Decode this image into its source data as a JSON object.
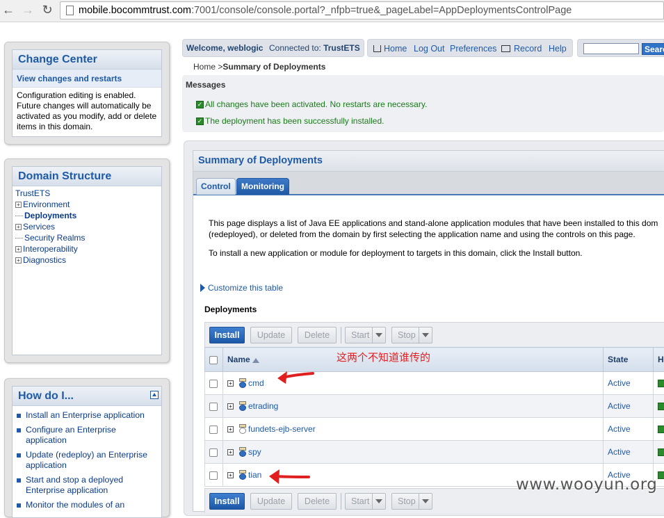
{
  "browser": {
    "url_host": "mobile.bocommtrust.com",
    "url_rest": ":7001/console/console.portal?_nfpb=true&_pageLabel=AppDeploymentsControlPage"
  },
  "change_center": {
    "title": "Change Center",
    "subtitle": "View changes and restarts",
    "text": "Configuration editing is enabled. Future changes will automatically be activated as you modify, add or delete items in this domain."
  },
  "domain_structure": {
    "title": "Domain Structure",
    "root": "TrustETS",
    "items": [
      {
        "label": "Environment",
        "expandable": true,
        "bold": false
      },
      {
        "label": "Deployments",
        "expandable": false,
        "bold": true
      },
      {
        "label": "Services",
        "expandable": true,
        "bold": false
      },
      {
        "label": "Security Realms",
        "expandable": false,
        "bold": false
      },
      {
        "label": "Interoperability",
        "expandable": true,
        "bold": false
      },
      {
        "label": "Diagnostics",
        "expandable": true,
        "bold": false
      }
    ]
  },
  "how_do_i": {
    "title": "How do I...",
    "items": [
      "Install an Enterprise application",
      "Configure an Enterprise application",
      "Update (redeploy) an Enterprise application",
      "Start and stop a deployed Enterprise application",
      "Monitor the modules of an"
    ]
  },
  "header": {
    "welcome": "Welcome, weblogic",
    "connected_label": "Connected to:",
    "connected_value": "TrustETS",
    "links": {
      "home": "Home",
      "logout": "Log Out",
      "preferences": "Preferences",
      "record": "Record",
      "help": "Help"
    },
    "search_button": "Search"
  },
  "breadcrumb": {
    "home": "Home >",
    "current": "Summary of Deployments"
  },
  "messages": {
    "label": "Messages",
    "items": [
      "All changes have been activated. No restarts are necessary.",
      "The deployment has been successfully installed."
    ]
  },
  "main": {
    "title": "Summary of Deployments",
    "tabs": [
      "Control",
      "Monitoring"
    ],
    "description_line1": "This page displays a list of Java EE applications and stand-alone application modules that have been installed to this dom",
    "description_line2": "(redeployed), or deleted from the domain by first selecting the application name and using the controls on this page.",
    "description_line3": "To install a new application or module for deployment to targets in this domain, click the Install button.",
    "customize": "Customize this table",
    "deployments_label": "Deployments",
    "buttons": {
      "install": "Install",
      "update": "Update",
      "delete": "Delete",
      "start": "Start",
      "stop": "Stop"
    },
    "columns": {
      "name": "Name",
      "state": "State",
      "health": "H"
    },
    "rows": [
      {
        "name": "cmd",
        "state": "Active",
        "icon": "app-icon"
      },
      {
        "name": "etrading",
        "state": "Active",
        "icon": "app-icon"
      },
      {
        "name": "fundets-ejb-server",
        "state": "Active",
        "icon": "module-icon"
      },
      {
        "name": "spy",
        "state": "Active",
        "icon": "app-icon"
      },
      {
        "name": "tian",
        "state": "Active",
        "icon": "app-icon"
      }
    ]
  },
  "annotation": "这两个不知道谁传的",
  "watermark": "www.wooyun.org",
  "colors": {
    "accent": "#1f5aa6",
    "annotation": "#e02020",
    "success": "#1a7a1a"
  }
}
